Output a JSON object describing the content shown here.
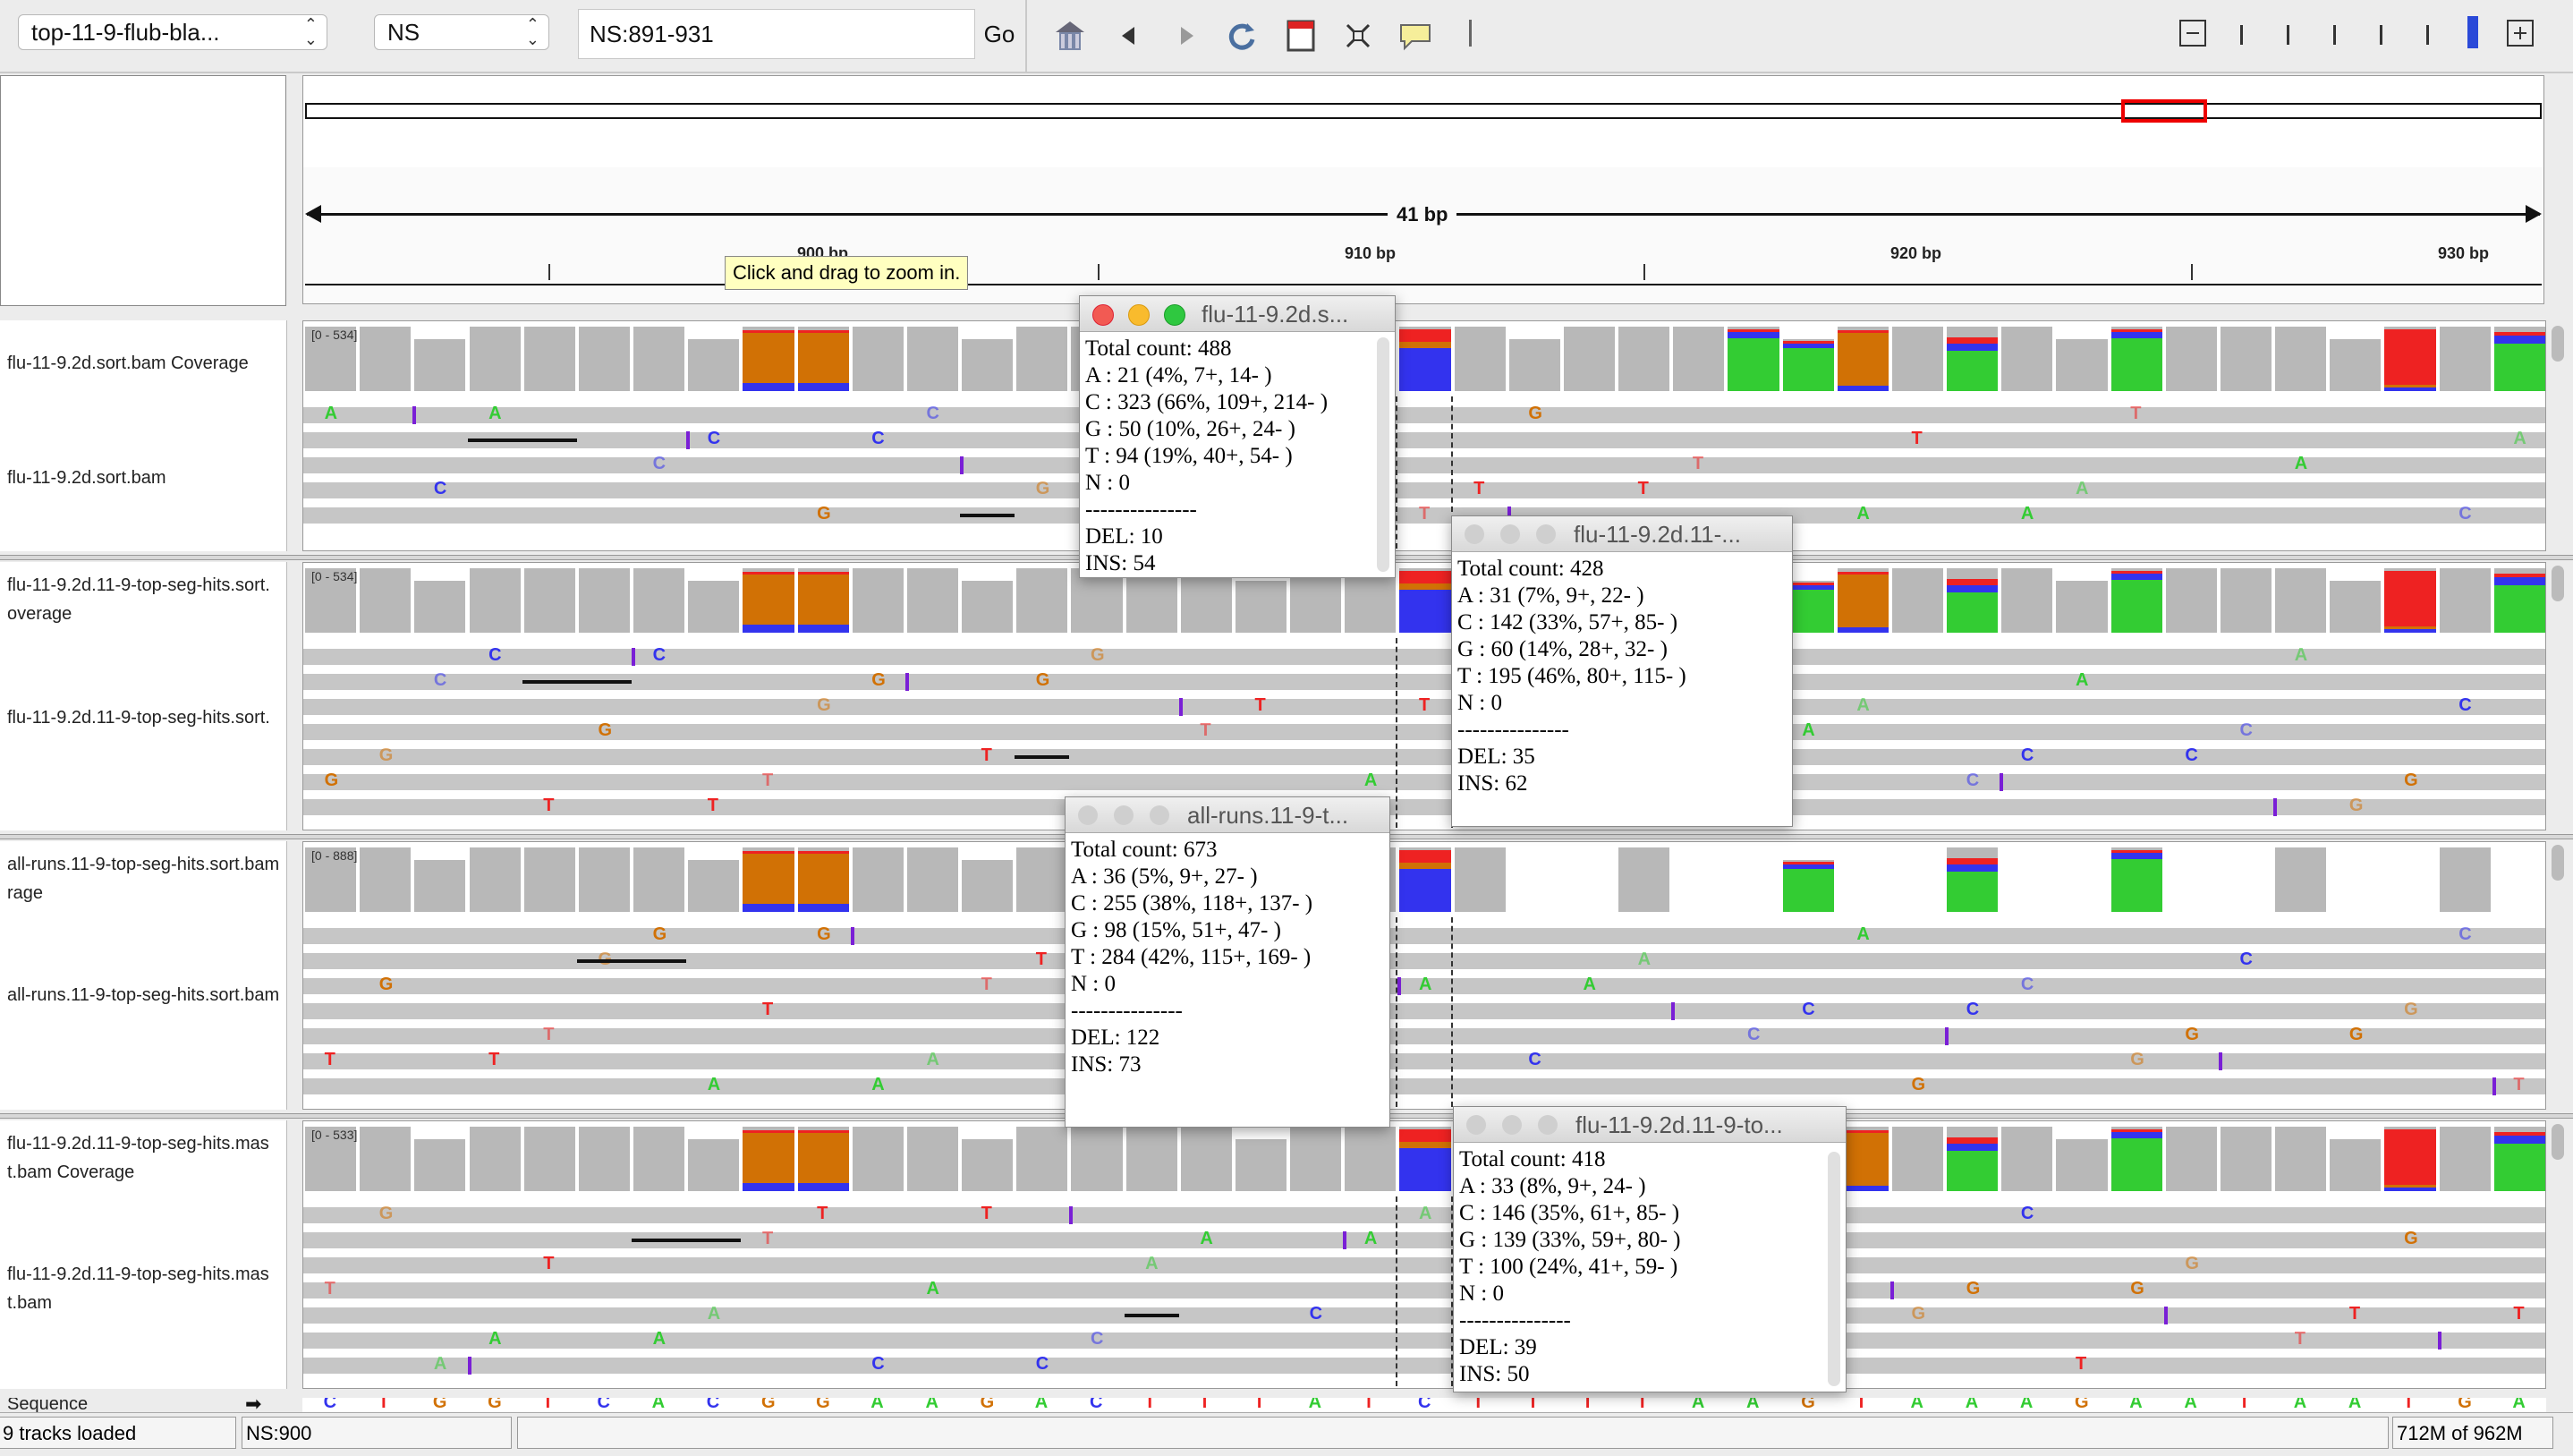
{
  "toolbar": {
    "genome_combo": "top-11-9-flub-bla...",
    "chrom_combo": "NS",
    "locus_value": "NS:891-931",
    "go_label": "Go"
  },
  "ruler": {
    "span_label": "41 bp",
    "ticks": [
      "900 bp",
      "910 bp",
      "920 bp",
      "930 bp"
    ],
    "tooltip": "Click and drag to zoom in."
  },
  "tracks": [
    {
      "coverage_label": "flu-11-9.2d.sort.bam Coverage",
      "reads_label": "flu-11-9.2d.sort.bam",
      "range": "[0 - 534]"
    },
    {
      "coverage_label": "flu-11-9.2d.11-9-top-seg-hits.sort.\noverage",
      "reads_label": "flu-11-9.2d.11-9-top-seg-hits.sort.",
      "range": "[0 - 534]"
    },
    {
      "coverage_label": "all-runs.11-9-top-seg-hits.sort.bam\nrage",
      "reads_label": "all-runs.11-9-top-seg-hits.sort.bam",
      "range": "[0 - 888]"
    },
    {
      "coverage_label": "flu-11-9.2d.11-9-top-seg-hits.mas\nt.bam Coverage",
      "reads_label": "flu-11-9.2d.11-9-top-seg-hits.mas\nt.bam",
      "range": "[0 - 533]"
    }
  ],
  "sequence": {
    "label": "Sequence",
    "bases": [
      "C",
      "T",
      "G",
      "G",
      "T",
      "C",
      "A",
      "C",
      "G",
      "G",
      "A",
      "A",
      "G",
      "A",
      "C",
      "T",
      "T",
      "T",
      "A",
      "T",
      "C",
      "T",
      "T",
      "T",
      "T",
      "A",
      "A",
      "G",
      "T",
      "A",
      "A",
      "A",
      "G",
      "A",
      "A",
      "T",
      "A",
      "A",
      "T",
      "G",
      "A"
    ]
  },
  "popups": [
    {
      "title": "flu-11-9.2d.s...",
      "lines": [
        "Total count: 488",
        "A : 21 (4%, 7+, 14- )",
        "C : 323 (66%, 109+, 214- )",
        "G : 50 (10%, 26+, 24- )",
        "T : 94 (19%, 40+, 54- )",
        "N : 0",
        "---------------",
        "DEL: 10",
        "INS: 54"
      ]
    },
    {
      "title": "flu-11-9.2d.11-...",
      "lines": [
        "Total count: 428",
        "A : 31 (7%, 9+, 22- )",
        "C : 142 (33%, 57+, 85- )",
        "G : 60 (14%, 28+, 32- )",
        "T : 195 (46%, 80+, 115- )",
        "N : 0",
        "---------------",
        "DEL: 35",
        "INS: 62"
      ]
    },
    {
      "title": "all-runs.11-9-t...",
      "lines": [
        "Total count: 673",
        "A : 36 (5%, 9+, 27- )",
        "C : 255 (38%, 118+, 137- )",
        "G : 98 (15%, 51+, 47- )",
        "T : 284 (42%, 115+, 169- )",
        "N : 0",
        "---------------",
        "DEL: 122",
        "INS: 73"
      ]
    },
    {
      "title": "flu-11-9.2d.11-9-to...",
      "lines": [
        "Total count: 418",
        "A : 33 (8%, 9+, 24- )",
        "C : 146 (35%, 61+, 85- )",
        "G : 139 (33%, 59+, 80- )",
        "T : 100 (24%, 41+, 59- )",
        "N : 0",
        "---------------",
        "DEL: 39",
        "INS: 50"
      ]
    }
  ],
  "status": {
    "tracks_loaded": "9 tracks loaded",
    "position": "NS:900",
    "memory": "712M of 962M"
  },
  "colors": {
    "A": "#33cc33",
    "C": "#3333ee",
    "G": "#d17105",
    "T": "#ee2222",
    "grey": "#b8b8b8",
    "insertion": "#7a1fd6"
  }
}
